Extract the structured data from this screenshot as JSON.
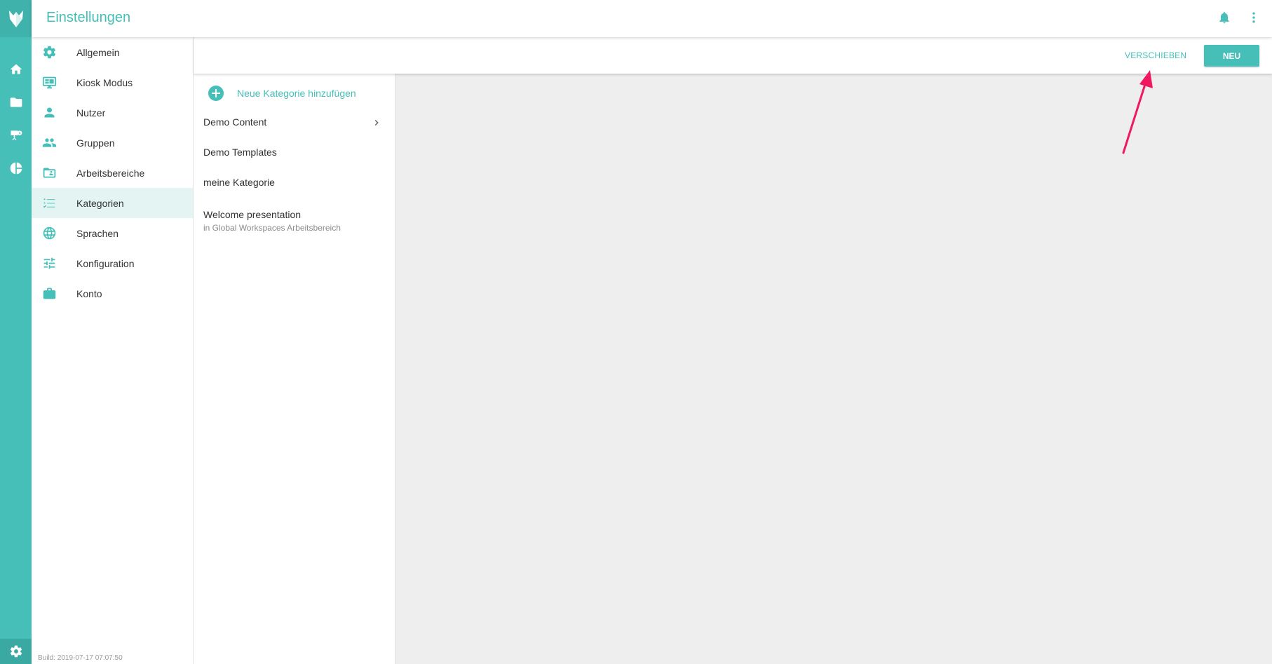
{
  "header": {
    "title": "Einstellungen"
  },
  "rail": {
    "items": [
      "home-icon",
      "folder-icon",
      "kiosk-presentation-icon",
      "pie-chart-icon"
    ],
    "bottom_icon": "gear-icon"
  },
  "nav": {
    "items": [
      {
        "label": "Allgemein",
        "icon": "gear-icon"
      },
      {
        "label": "Kiosk Modus",
        "icon": "monitor-icon"
      },
      {
        "label": "Nutzer",
        "icon": "person-icon"
      },
      {
        "label": "Gruppen",
        "icon": "group-icon"
      },
      {
        "label": "Arbeitsbereiche",
        "icon": "workspace-folder-icon"
      },
      {
        "label": "Kategorien",
        "icon": "checklist-icon",
        "active": true
      },
      {
        "label": "Sprachen",
        "icon": "globe-icon"
      },
      {
        "label": "Konfiguration",
        "icon": "sliders-icon"
      },
      {
        "label": "Konto",
        "icon": "briefcase-icon"
      }
    ],
    "build": "Build: 2019-07-17 07:07:50"
  },
  "toolbar": {
    "move_label": "VERSCHIEBEN",
    "new_label": "NEU"
  },
  "categories": {
    "add_label": "Neue Kategorie hinzufügen",
    "items": [
      {
        "label": "Demo Content",
        "has_children": true
      },
      {
        "label": "Demo Templates"
      },
      {
        "label": "meine Kategorie"
      },
      {
        "label": "Welcome presentation",
        "sub": "in Global Workspaces Arbeitsbereich"
      }
    ]
  },
  "colors": {
    "accent": "#45bfb8",
    "rail": "#45bfb8",
    "active_bg": "#e3f4f3",
    "annotation": "#f0185f"
  }
}
